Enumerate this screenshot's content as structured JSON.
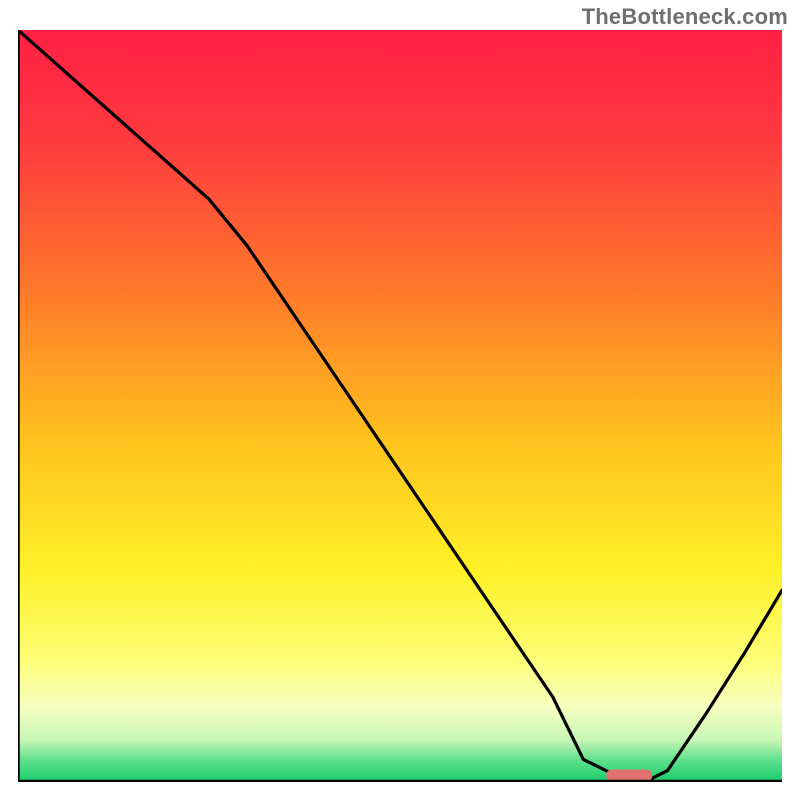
{
  "watermark": "TheBottleneck.com",
  "chart_data": {
    "type": "line",
    "title": "",
    "xlabel": "",
    "ylabel": "",
    "x": [
      0.0,
      0.05,
      0.1,
      0.15,
      0.2,
      0.25,
      0.3,
      0.35,
      0.4,
      0.45,
      0.5,
      0.55,
      0.6,
      0.65,
      0.7,
      0.74,
      0.8,
      0.82,
      0.85,
      0.9,
      0.95,
      1.0
    ],
    "values": [
      1.0,
      0.955,
      0.91,
      0.865,
      0.82,
      0.775,
      0.713,
      0.638,
      0.563,
      0.488,
      0.413,
      0.338,
      0.263,
      0.188,
      0.113,
      0.03,
      0.0,
      0.0,
      0.015,
      0.09,
      0.17,
      0.255
    ],
    "xlim": [
      0,
      1
    ],
    "ylim": [
      0,
      1
    ],
    "marker": {
      "x0": 0.77,
      "x1": 0.83,
      "y": 0.006
    },
    "gradient_stops": [
      {
        "offset": 0.0,
        "color": "#ff1f44"
      },
      {
        "offset": 0.15,
        "color": "#ff3b3f"
      },
      {
        "offset": 0.35,
        "color": "#ff7a2a"
      },
      {
        "offset": 0.55,
        "color": "#ffc41e"
      },
      {
        "offset": 0.72,
        "color": "#fff128"
      },
      {
        "offset": 0.84,
        "color": "#fdfe78"
      },
      {
        "offset": 0.9,
        "color": "#f6ffbf"
      },
      {
        "offset": 0.945,
        "color": "#c7f6b5"
      },
      {
        "offset": 0.97,
        "color": "#62e08f"
      },
      {
        "offset": 1.0,
        "color": "#18cd6a"
      }
    ]
  }
}
